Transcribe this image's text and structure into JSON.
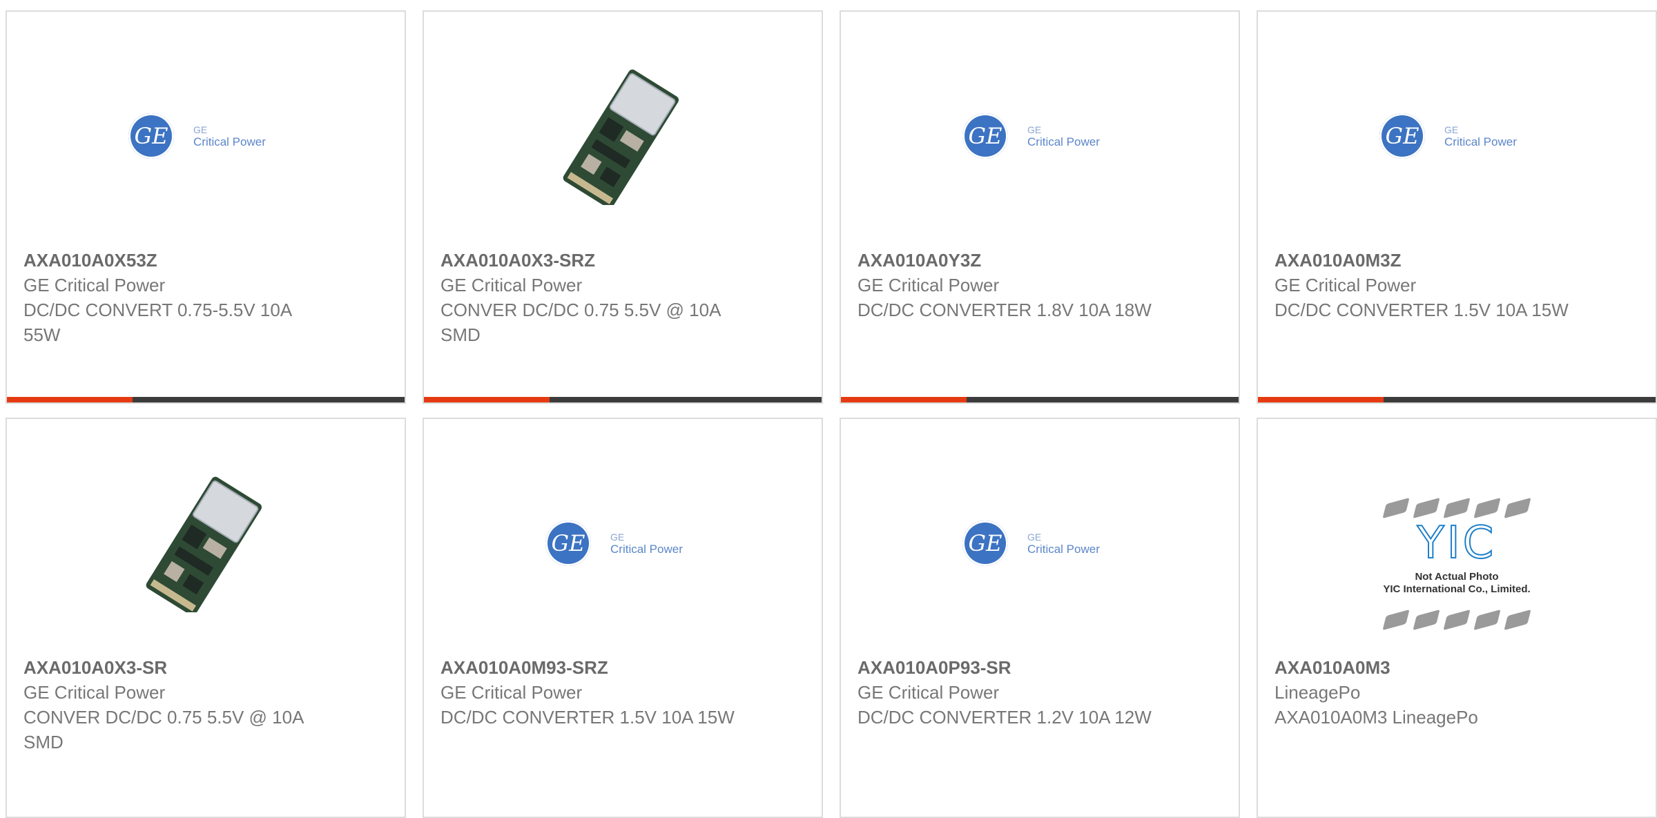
{
  "products": [
    {
      "image": "ge-critical-power-logo",
      "part_number": "AXA010A0X53Z",
      "manufacturer": "GE Critical Power",
      "description": "DC/DC CONVERT 0.75-5.5V 10A 55W"
    },
    {
      "image": "dc-dc-module-photo",
      "part_number": "AXA010A0X3-SRZ",
      "manufacturer": "GE Critical Power",
      "description": "CONVER DC/DC 0.75 5.5V @ 10A SMD"
    },
    {
      "image": "ge-critical-power-logo",
      "part_number": "AXA010A0Y3Z",
      "manufacturer": "GE Critical Power",
      "description": "DC/DC CONVERTER 1.8V 10A 18W"
    },
    {
      "image": "ge-critical-power-logo",
      "part_number": "AXA010A0M3Z",
      "manufacturer": "GE Critical Power",
      "description": "DC/DC CONVERTER 1.5V 10A 15W"
    },
    {
      "image": "dc-dc-module-photo",
      "part_number": "AXA010A0X3-SR",
      "manufacturer": "GE Critical Power",
      "description": "CONVER DC/DC 0.75 5.5V @ 10A SMD"
    },
    {
      "image": "ge-critical-power-logo",
      "part_number": "AXA010A0M93-SRZ",
      "manufacturer": "GE Critical Power",
      "description": "DC/DC CONVERTER 1.5V 10A 15W"
    },
    {
      "image": "ge-critical-power-logo",
      "part_number": "AXA010A0P93-SR",
      "manufacturer": "GE Critical Power",
      "description": "DC/DC CONVERTER 1.2V 10A 12W"
    },
    {
      "image": "yic-not-actual-photo",
      "part_number": "AXA010A0M3",
      "manufacturer": "LineagePo",
      "description": "AXA010A0M3 LineagePo"
    }
  ],
  "ge_logo": {
    "line1": "GE",
    "line2": "Critical Power",
    "monogram": "GE"
  },
  "yic_placeholder": {
    "mark": "YIC",
    "line1": "Not Actual Photo",
    "line2": "YIC International Co., Limited."
  },
  "colors": {
    "accent": "#e63b12",
    "bar": "#3c3c3c",
    "border": "#dcdcdc",
    "text": "#777777",
    "ge_blue": "#3c73c2",
    "yic_blue": "#1f7fc9"
  }
}
